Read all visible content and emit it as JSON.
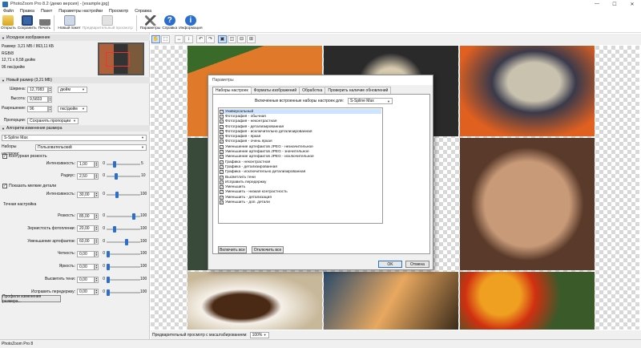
{
  "window": {
    "title": "PhotoZoom Pro 8.2 (демо версия) - [example.jpg]",
    "minimize": "—",
    "maximize": "☐",
    "close": "✕"
  },
  "menu": [
    "Файл",
    "Правка",
    "Пакет",
    "Параметры настройки",
    "Просмотр",
    "Справка"
  ],
  "toolbar": {
    "open": "Открыть",
    "save": "Сохранить",
    "print": "Печать",
    "new_batch": "Новый пакет",
    "preview_split": "Предварительный просмотр",
    "settings": "Параметры",
    "help": "Справка",
    "info": "Информация"
  },
  "source": {
    "header": "Исходное изображение",
    "size": "Размер: 3,21 МБ / 863,11 КБ",
    "color": "RGB/8",
    "dimensions": "12,71 x 9,58 дюйм",
    "dpi": "96 пкс/дюйм"
  },
  "new_size": {
    "header": "Новый размер (3,21 МБ)",
    "width_label": "Ширина:",
    "width_value": "12,7083",
    "width_unit": "дюйм",
    "height_label": "Высота:",
    "height_value": "9,5833",
    "resolution_label": "Разрешение:",
    "resolution_value": "96",
    "resolution_unit": "пкс/дюйм",
    "proportions_label": "Пропорции:",
    "proportions_value": "Сохранять пропорции"
  },
  "algorithm": {
    "header": "Алгоритм изменения размера",
    "method": "S-Spline Max",
    "preset_label": "Наборы настроек:",
    "preset_value": "Пользовательский",
    "contour_label": "Контурная резкость",
    "intensity_label": "Интенсивность:",
    "intensity_value": "1,00",
    "intensity_min": "0",
    "intensity_max": "5",
    "intensity_level": 0.2,
    "radius_label": "Радиус:",
    "radius_value": "2,50",
    "radius_min": "0",
    "radius_max": "10",
    "radius_level": 0.25,
    "details_label": "Показать мелкие детали",
    "details_intensity_label": "Интенсивность:",
    "details_intensity_value": "30,00",
    "details_min": "0",
    "details_max": "100",
    "details_level": 0.3
  },
  "fine_tuning": {
    "header": "Точная настройка",
    "min": "0",
    "max": "100",
    "rows": [
      {
        "label": "Резкость:",
        "value": "85,00",
        "level": 0.85
      },
      {
        "label": "Зернистость фотопленки:",
        "value": "20,00",
        "level": 0.2
      },
      {
        "label": "Уменьшение артефактов:",
        "value": "60,00",
        "level": 0.6
      },
      {
        "label": "Четкость:",
        "value": "0,00",
        "level": 0.0
      },
      {
        "label": "Яркость:",
        "value": "0,00",
        "level": 0.0
      },
      {
        "label": "Высветить тени:",
        "value": "0,00",
        "level": 0.0
      },
      {
        "label": "Исправить передержку:",
        "value": "0,00",
        "level": 0.0
      }
    ],
    "profiles_button": "Профили изменения размера..."
  },
  "preview": {
    "label": "Предварительный просмотр с масштабированием:",
    "zoom": "100%"
  },
  "status": "PhotoZoom Pro 8",
  "dialog": {
    "title": "Параметры",
    "tabs": [
      "Наборы настроек",
      "Форматы изображений",
      "Обработка",
      "Проверить наличие обновлений"
    ],
    "presets_for_label": "Включенные встроенные наборы настроек для:",
    "presets_for_value": "S-Spline Max",
    "items": [
      "Универсальный",
      "Фотография - обычная",
      "Фотография - неконтрастная",
      "Фотография - детализированная",
      "Фотография - исключительно детализированная",
      "Фотография - яркая",
      "Фотография - очень яркая",
      "Уменьшение артефактов JPEG - незначительное",
      "Уменьшение артефактов JPEG - значительное",
      "Уменьшение артефактов JPEG - исключительное",
      "Графика - неконтрастная",
      "Графика - детализированная",
      "Графика - исключительно детализированная",
      "Высветлить тени",
      "Исправить передержку",
      "Уменьшить",
      "Уменьшить - низкая контрастность",
      "Уменьшить - детализация",
      "Уменьшить - доп. детали"
    ],
    "enable_all": "Включить все",
    "disable_all": "Отключить все",
    "ok": "OK",
    "cancel": "Отмена"
  },
  "colors": {
    "accent": "#2a6fd0",
    "selection": "#cce4ff"
  }
}
